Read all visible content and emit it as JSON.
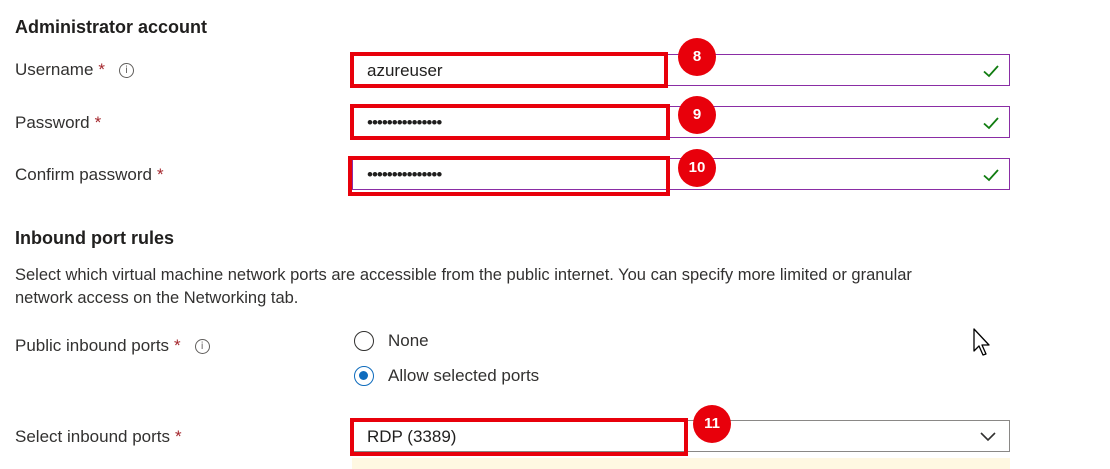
{
  "admin": {
    "heading": "Administrator account",
    "username": {
      "label": "Username",
      "required": "*",
      "info": "i",
      "value": "azureuser"
    },
    "password": {
      "label": "Password",
      "required": "*",
      "value": "•••••••••••••••"
    },
    "confirm": {
      "label": "Confirm password",
      "required": "*",
      "value": "•••••••••••••••"
    }
  },
  "inbound": {
    "heading": "Inbound port rules",
    "description_line1": "Select which virtual machine network ports are accessible from the public internet. You can specify more limited or granular",
    "description_line2": "network access on the Networking tab.",
    "public_ports": {
      "label": "Public inbound ports",
      "required": "*",
      "info": "i",
      "options": [
        {
          "label": "None",
          "selected": false
        },
        {
          "label": "Allow selected ports",
          "selected": true
        }
      ]
    },
    "select_ports": {
      "label": "Select inbound ports",
      "required": "*",
      "value": "RDP (3389)"
    }
  },
  "callouts": [
    "8",
    "9",
    "10",
    "11"
  ],
  "colors": {
    "callout": "#e8000b",
    "valid_border": "#8a2da5",
    "check": "#107c10",
    "radio_selected": "#0f6cbd"
  }
}
